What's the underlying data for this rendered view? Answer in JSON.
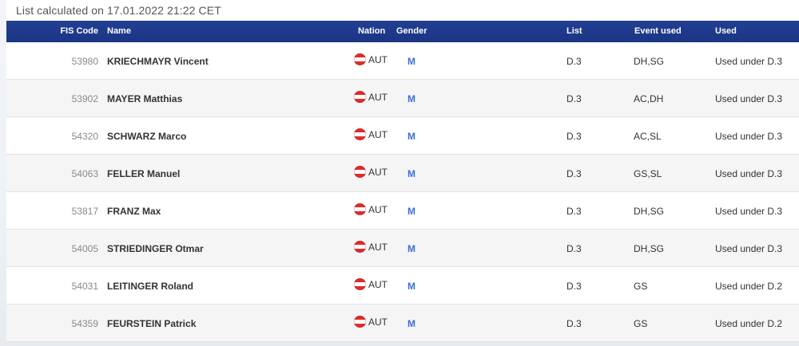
{
  "calc_info": "List calculated on 17.01.2022 21:22 CET",
  "columns": {
    "fis_code": "FIS Code",
    "name": "Name",
    "nation": "Nation",
    "gender": "Gender",
    "list": "List",
    "event_used": "Event used",
    "used": "Used"
  },
  "rows": [
    {
      "fis": "53980",
      "name": "KRIECHMAYR Vincent",
      "nation": "AUT",
      "gender": "M",
      "list": "D.3",
      "event": "DH,SG",
      "used": "Used under D.3"
    },
    {
      "fis": "53902",
      "name": "MAYER Matthias",
      "nation": "AUT",
      "gender": "M",
      "list": "D.3",
      "event": "AC,DH",
      "used": "Used under D.3"
    },
    {
      "fis": "54320",
      "name": "SCHWARZ Marco",
      "nation": "AUT",
      "gender": "M",
      "list": "D.3",
      "event": "AC,SL",
      "used": "Used under D.3"
    },
    {
      "fis": "54063",
      "name": "FELLER Manuel",
      "nation": "AUT",
      "gender": "M",
      "list": "D.3",
      "event": "GS,SL",
      "used": "Used under D.3"
    },
    {
      "fis": "53817",
      "name": "FRANZ Max",
      "nation": "AUT",
      "gender": "M",
      "list": "D.3",
      "event": "DH,SG",
      "used": "Used under D.3"
    },
    {
      "fis": "54005",
      "name": "STRIEDINGER Otmar",
      "nation": "AUT",
      "gender": "M",
      "list": "D.3",
      "event": "DH,SG",
      "used": "Used under D.3"
    },
    {
      "fis": "54031",
      "name": "LEITINGER Roland",
      "nation": "AUT",
      "gender": "M",
      "list": "D.3",
      "event": "GS",
      "used": "Used under D.2"
    },
    {
      "fis": "54359",
      "name": "FEURSTEIN Patrick",
      "nation": "AUT",
      "gender": "M",
      "list": "D.3",
      "event": "GS",
      "used": "Used under D.2"
    }
  ],
  "colors": {
    "header_bg": "#1e3a8a",
    "gender_male": "#3b6fd6",
    "flag_red": "#e02b2b"
  },
  "icons": {
    "nation_flag": "austria-flag-icon"
  }
}
